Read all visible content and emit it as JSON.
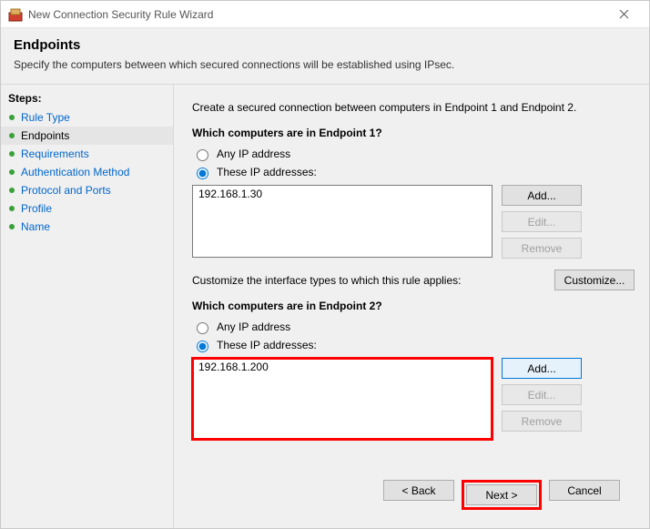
{
  "titlebar": {
    "title": "New Connection Security Rule Wizard"
  },
  "header": {
    "title": "Endpoints",
    "subtitle": "Specify the computers between which secured connections will be established using IPsec."
  },
  "sidebar": {
    "label": "Steps:",
    "items": [
      {
        "label": "Rule Type",
        "active": false
      },
      {
        "label": "Endpoints",
        "active": true
      },
      {
        "label": "Requirements",
        "active": false
      },
      {
        "label": "Authentication Method",
        "active": false
      },
      {
        "label": "Protocol and Ports",
        "active": false
      },
      {
        "label": "Profile",
        "active": false
      },
      {
        "label": "Name",
        "active": false
      }
    ]
  },
  "main": {
    "intro": "Create a secured connection between computers in Endpoint 1 and Endpoint 2.",
    "ep1": {
      "question": "Which computers are in Endpoint 1?",
      "opt_any": "Any IP address",
      "opt_these": "These IP addresses:",
      "entries": [
        "192.168.1.30"
      ],
      "add": "Add...",
      "edit": "Edit...",
      "remove": "Remove"
    },
    "customize": {
      "text": "Customize the interface types to which this rule applies:",
      "button": "Customize..."
    },
    "ep2": {
      "question": "Which computers are in Endpoint 2?",
      "opt_any": "Any IP address",
      "opt_these": "These IP addresses:",
      "entries": [
        "192.168.1.200"
      ],
      "add": "Add...",
      "edit": "Edit...",
      "remove": "Remove"
    }
  },
  "footer": {
    "back": "< Back",
    "next": "Next >",
    "cancel": "Cancel"
  }
}
